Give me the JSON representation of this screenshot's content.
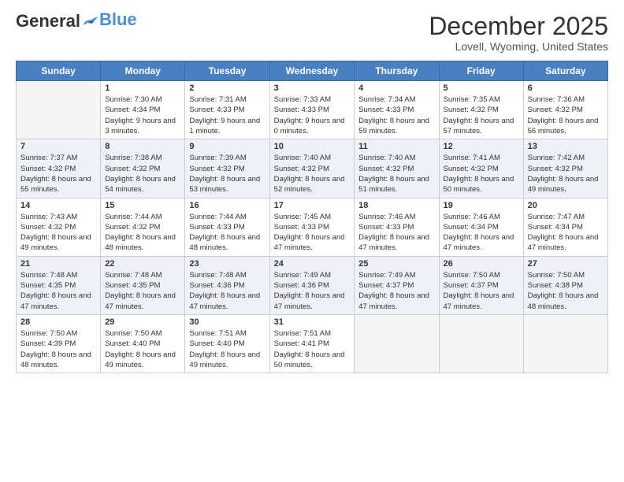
{
  "header": {
    "logo_general": "General",
    "logo_blue": "Blue",
    "month": "December 2025",
    "location": "Lovell, Wyoming, United States"
  },
  "weekdays": [
    "Sunday",
    "Monday",
    "Tuesday",
    "Wednesday",
    "Thursday",
    "Friday",
    "Saturday"
  ],
  "weeks": [
    [
      {
        "day": "",
        "sunrise": "",
        "sunset": "",
        "daylight": ""
      },
      {
        "day": "1",
        "sunrise": "Sunrise: 7:30 AM",
        "sunset": "Sunset: 4:34 PM",
        "daylight": "Daylight: 9 hours and 3 minutes."
      },
      {
        "day": "2",
        "sunrise": "Sunrise: 7:31 AM",
        "sunset": "Sunset: 4:33 PM",
        "daylight": "Daylight: 9 hours and 1 minute."
      },
      {
        "day": "3",
        "sunrise": "Sunrise: 7:33 AM",
        "sunset": "Sunset: 4:33 PM",
        "daylight": "Daylight: 9 hours and 0 minutes."
      },
      {
        "day": "4",
        "sunrise": "Sunrise: 7:34 AM",
        "sunset": "Sunset: 4:33 PM",
        "daylight": "Daylight: 8 hours and 59 minutes."
      },
      {
        "day": "5",
        "sunrise": "Sunrise: 7:35 AM",
        "sunset": "Sunset: 4:32 PM",
        "daylight": "Daylight: 8 hours and 57 minutes."
      },
      {
        "day": "6",
        "sunrise": "Sunrise: 7:36 AM",
        "sunset": "Sunset: 4:32 PM",
        "daylight": "Daylight: 8 hours and 56 minutes."
      }
    ],
    [
      {
        "day": "7",
        "sunrise": "Sunrise: 7:37 AM",
        "sunset": "Sunset: 4:32 PM",
        "daylight": "Daylight: 8 hours and 55 minutes."
      },
      {
        "day": "8",
        "sunrise": "Sunrise: 7:38 AM",
        "sunset": "Sunset: 4:32 PM",
        "daylight": "Daylight: 8 hours and 54 minutes."
      },
      {
        "day": "9",
        "sunrise": "Sunrise: 7:39 AM",
        "sunset": "Sunset: 4:32 PM",
        "daylight": "Daylight: 8 hours and 53 minutes."
      },
      {
        "day": "10",
        "sunrise": "Sunrise: 7:40 AM",
        "sunset": "Sunset: 4:32 PM",
        "daylight": "Daylight: 8 hours and 52 minutes."
      },
      {
        "day": "11",
        "sunrise": "Sunrise: 7:40 AM",
        "sunset": "Sunset: 4:32 PM",
        "daylight": "Daylight: 8 hours and 51 minutes."
      },
      {
        "day": "12",
        "sunrise": "Sunrise: 7:41 AM",
        "sunset": "Sunset: 4:32 PM",
        "daylight": "Daylight: 8 hours and 50 minutes."
      },
      {
        "day": "13",
        "sunrise": "Sunrise: 7:42 AM",
        "sunset": "Sunset: 4:32 PM",
        "daylight": "Daylight: 8 hours and 49 minutes."
      }
    ],
    [
      {
        "day": "14",
        "sunrise": "Sunrise: 7:43 AM",
        "sunset": "Sunset: 4:32 PM",
        "daylight": "Daylight: 8 hours and 49 minutes."
      },
      {
        "day": "15",
        "sunrise": "Sunrise: 7:44 AM",
        "sunset": "Sunset: 4:32 PM",
        "daylight": "Daylight: 8 hours and 48 minutes."
      },
      {
        "day": "16",
        "sunrise": "Sunrise: 7:44 AM",
        "sunset": "Sunset: 4:33 PM",
        "daylight": "Daylight: 8 hours and 48 minutes."
      },
      {
        "day": "17",
        "sunrise": "Sunrise: 7:45 AM",
        "sunset": "Sunset: 4:33 PM",
        "daylight": "Daylight: 8 hours and 47 minutes."
      },
      {
        "day": "18",
        "sunrise": "Sunrise: 7:46 AM",
        "sunset": "Sunset: 4:33 PM",
        "daylight": "Daylight: 8 hours and 47 minutes."
      },
      {
        "day": "19",
        "sunrise": "Sunrise: 7:46 AM",
        "sunset": "Sunset: 4:34 PM",
        "daylight": "Daylight: 8 hours and 47 minutes."
      },
      {
        "day": "20",
        "sunrise": "Sunrise: 7:47 AM",
        "sunset": "Sunset: 4:34 PM",
        "daylight": "Daylight: 8 hours and 47 minutes."
      }
    ],
    [
      {
        "day": "21",
        "sunrise": "Sunrise: 7:48 AM",
        "sunset": "Sunset: 4:35 PM",
        "daylight": "Daylight: 8 hours and 47 minutes."
      },
      {
        "day": "22",
        "sunrise": "Sunrise: 7:48 AM",
        "sunset": "Sunset: 4:35 PM",
        "daylight": "Daylight: 8 hours and 47 minutes."
      },
      {
        "day": "23",
        "sunrise": "Sunrise: 7:48 AM",
        "sunset": "Sunset: 4:36 PM",
        "daylight": "Daylight: 8 hours and 47 minutes."
      },
      {
        "day": "24",
        "sunrise": "Sunrise: 7:49 AM",
        "sunset": "Sunset: 4:36 PM",
        "daylight": "Daylight: 8 hours and 47 minutes."
      },
      {
        "day": "25",
        "sunrise": "Sunrise: 7:49 AM",
        "sunset": "Sunset: 4:37 PM",
        "daylight": "Daylight: 8 hours and 47 minutes."
      },
      {
        "day": "26",
        "sunrise": "Sunrise: 7:50 AM",
        "sunset": "Sunset: 4:37 PM",
        "daylight": "Daylight: 8 hours and 47 minutes."
      },
      {
        "day": "27",
        "sunrise": "Sunrise: 7:50 AM",
        "sunset": "Sunset: 4:38 PM",
        "daylight": "Daylight: 8 hours and 48 minutes."
      }
    ],
    [
      {
        "day": "28",
        "sunrise": "Sunrise: 7:50 AM",
        "sunset": "Sunset: 4:39 PM",
        "daylight": "Daylight: 8 hours and 48 minutes."
      },
      {
        "day": "29",
        "sunrise": "Sunrise: 7:50 AM",
        "sunset": "Sunset: 4:40 PM",
        "daylight": "Daylight: 8 hours and 49 minutes."
      },
      {
        "day": "30",
        "sunrise": "Sunrise: 7:51 AM",
        "sunset": "Sunset: 4:40 PM",
        "daylight": "Daylight: 8 hours and 49 minutes."
      },
      {
        "day": "31",
        "sunrise": "Sunrise: 7:51 AM",
        "sunset": "Sunset: 4:41 PM",
        "daylight": "Daylight: 8 hours and 50 minutes."
      },
      {
        "day": "",
        "sunrise": "",
        "sunset": "",
        "daylight": ""
      },
      {
        "day": "",
        "sunrise": "",
        "sunset": "",
        "daylight": ""
      },
      {
        "day": "",
        "sunrise": "",
        "sunset": "",
        "daylight": ""
      }
    ]
  ]
}
